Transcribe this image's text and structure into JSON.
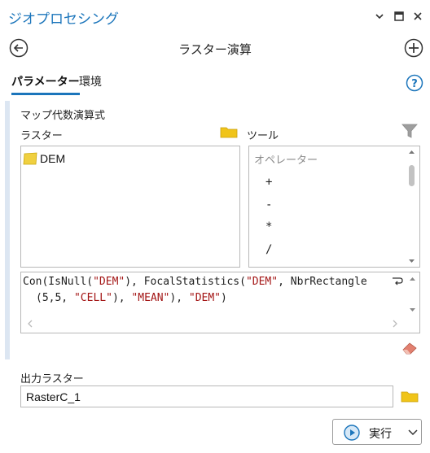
{
  "pane": {
    "title": "ジオプロセシング",
    "window_controls": [
      "chevron-down-icon",
      "maximize-icon",
      "close-icon"
    ]
  },
  "tool": {
    "title": "ラスター演算",
    "back_icon": "back-arrow-icon",
    "add_icon": "add-icon"
  },
  "tabs": [
    {
      "label": "パラメーター",
      "active": true
    },
    {
      "label": "環境",
      "active": false
    }
  ],
  "expression_section": {
    "label": "マップ代数演算式",
    "raster_header": "ラスター",
    "tools_header": "ツール",
    "rasters": [
      {
        "name": "DEM",
        "icon": "raster-layer-icon"
      }
    ],
    "tools_category": "オペレーター",
    "operators": [
      "+",
      "-",
      "*",
      "/"
    ],
    "expression_line1": "Con(IsNull(\"DEM\"), FocalStatistics(\"DEM\", NbrRectangle",
    "expression_line2": "(5,5, \"CELL\"), \"MEAN\"), \"DEM\")"
  },
  "output": {
    "label": "出力ラスター",
    "value": "RasterC_1"
  },
  "run_button": {
    "label": "実行"
  },
  "colors": {
    "accent": "#1b75bb",
    "folder": "#f0c419",
    "string_literal": "#a31515"
  }
}
